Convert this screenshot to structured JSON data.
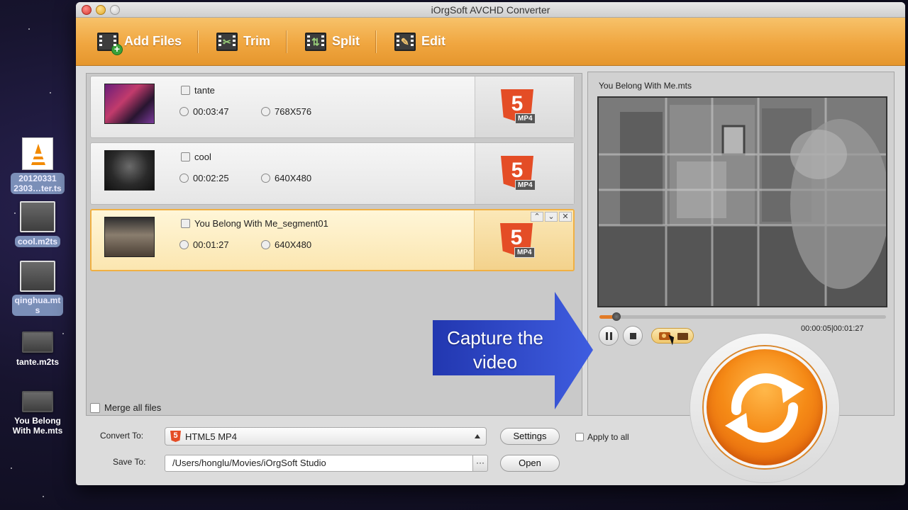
{
  "app": {
    "title": "iOrgSoft AVCHD Converter"
  },
  "toolbar": {
    "items": [
      {
        "label": "Add Files",
        "icon": "add-files-icon"
      },
      {
        "label": "Trim",
        "icon": "trim-icon"
      },
      {
        "label": "Split",
        "icon": "split-icon"
      },
      {
        "label": "Edit",
        "icon": "edit-icon"
      }
    ]
  },
  "files": [
    {
      "name": "tante",
      "duration": "00:03:47",
      "resolution": "768X576",
      "format": "5",
      "format_badge": "MP4"
    },
    {
      "name": "cool",
      "duration": "00:02:25",
      "resolution": "640X480",
      "format": "5",
      "format_badge": "MP4"
    },
    {
      "name": "You Belong With Me_segment01",
      "duration": "00:01:27",
      "resolution": "640X480",
      "format": "5",
      "format_badge": "MP4",
      "selected": true
    }
  ],
  "merge": {
    "label": "Merge all files",
    "checked": false
  },
  "preview": {
    "filename": "You Belong With Me.mts",
    "time": "00:00:05|00:01:27",
    "progress": 0.06
  },
  "output": {
    "convert_to_label": "Convert To:",
    "format_value": "HTML5 MP4",
    "format_icon_text": "5",
    "settings_label": "Settings",
    "apply_all_label": "Apply to all",
    "save_to_label": "Save To:",
    "save_path": "/Users/honglu/Movies/iOrgSoft Studio",
    "browse_label": "···",
    "open_label": "Open"
  },
  "callout": {
    "text": "Capture the\nvideo"
  },
  "desktop": [
    {
      "label": "20120331\n2303…ter.ts",
      "selected": true,
      "kind": "vlc"
    },
    {
      "label": "cool.m2ts",
      "selected": true,
      "kind": "video"
    },
    {
      "label": "qinghua.mt\ns",
      "selected": true,
      "kind": "video"
    },
    {
      "label": "tante.m2ts",
      "selected": false,
      "kind": "video"
    },
    {
      "label": "You Belong\nWith Me.mts",
      "selected": false,
      "kind": "video"
    }
  ],
  "colors": {
    "accent": "#f0a640",
    "convert": "#f58a16",
    "html5": "#e44d26",
    "callout": "#1f35b8"
  }
}
